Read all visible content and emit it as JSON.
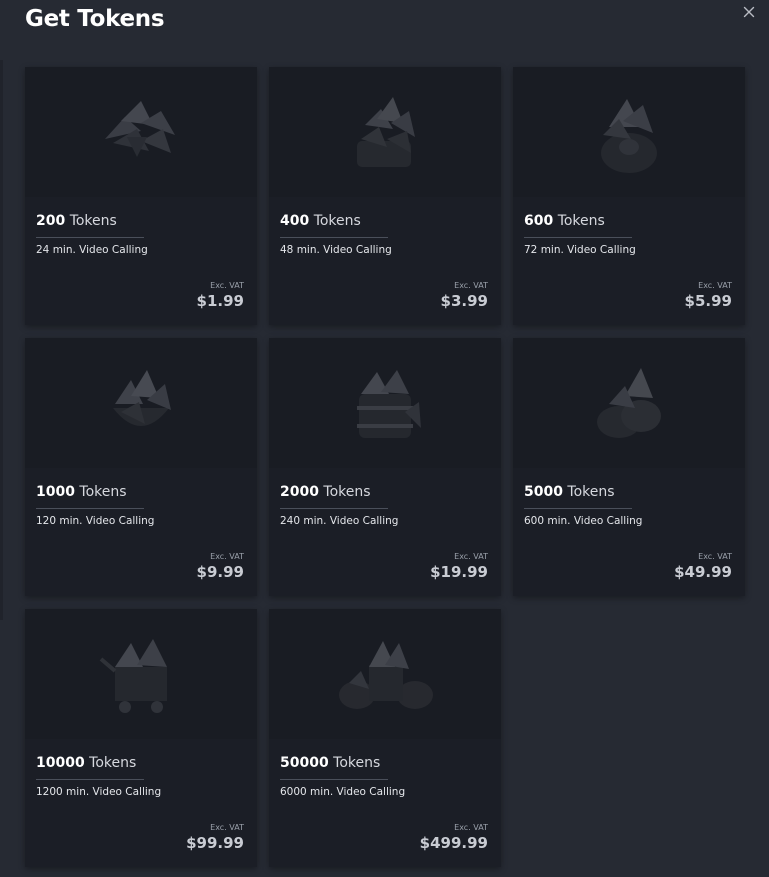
{
  "dialog": {
    "title": "Get Tokens",
    "close_label": "×"
  },
  "packages": [
    {
      "amount": "200",
      "unit": "Tokens",
      "minutes": "24 min. Video Calling",
      "vat_label": "Exc. VAT",
      "price": "$1.99",
      "icon": "token-pile-icon"
    },
    {
      "amount": "400",
      "unit": "Tokens",
      "minutes": "48 min. Video Calling",
      "vat_label": "Exc. VAT",
      "price": "$3.99",
      "icon": "token-bag-icon"
    },
    {
      "amount": "600",
      "unit": "Tokens",
      "minutes": "72 min. Video Calling",
      "vat_label": "Exc. VAT",
      "price": "$5.99",
      "icon": "token-sack-icon"
    },
    {
      "amount": "1000",
      "unit": "Tokens",
      "minutes": "120 min. Video Calling",
      "vat_label": "Exc. VAT",
      "price": "$9.99",
      "icon": "token-basket-icon"
    },
    {
      "amount": "2000",
      "unit": "Tokens",
      "minutes": "240 min. Video Calling",
      "vat_label": "Exc. VAT",
      "price": "$19.99",
      "icon": "token-barrel-icon"
    },
    {
      "amount": "5000",
      "unit": "Tokens",
      "minutes": "600 min. Video Calling",
      "vat_label": "Exc. VAT",
      "price": "$49.99",
      "icon": "token-bags-icon"
    },
    {
      "amount": "10000",
      "unit": "Tokens",
      "minutes": "1200 min. Video Calling",
      "vat_label": "Exc. VAT",
      "price": "$99.99",
      "icon": "token-cart-icon"
    },
    {
      "amount": "50000",
      "unit": "Tokens",
      "minutes": "6000 min. Video Calling",
      "vat_label": "Exc. VAT",
      "price": "$499.99",
      "icon": "token-hoard-icon"
    }
  ],
  "colors": {
    "background": "#262a33",
    "card": "#1b1e26",
    "text": "#ffffff",
    "muted": "#9aa0aa"
  }
}
